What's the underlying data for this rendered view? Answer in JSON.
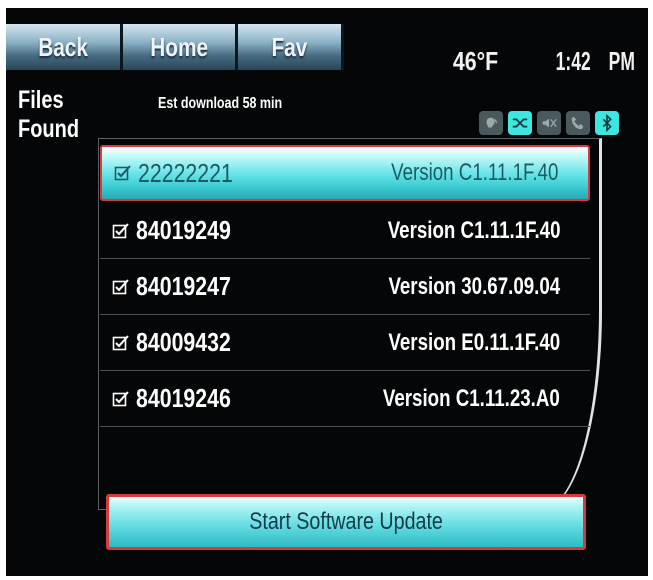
{
  "tabs": [
    {
      "label": "Back"
    },
    {
      "label": "Home"
    },
    {
      "label": "Fav"
    }
  ],
  "status": {
    "temperature": "46°F",
    "time": "1:42",
    "ampm": "PM"
  },
  "header": {
    "title": "Files Found",
    "estimate": "Est download 58 min"
  },
  "status_icons": [
    {
      "name": "voice-icon",
      "active": false
    },
    {
      "name": "shuffle-icon",
      "active": true
    },
    {
      "name": "mute-icon",
      "active": false
    },
    {
      "name": "phone-icon",
      "active": false
    },
    {
      "name": "bluetooth-icon",
      "active": true
    }
  ],
  "files": [
    {
      "id": "22222221",
      "version": "Version C1.11.1F.40",
      "checked": true,
      "selected": true
    },
    {
      "id": "84019249",
      "version": "Version C1.11.1F.40",
      "checked": true,
      "selected": false
    },
    {
      "id": "84019247",
      "version": "Version 30.67.09.04",
      "checked": true,
      "selected": false
    },
    {
      "id": "84009432",
      "version": "Version E0.11.1F.40",
      "checked": true,
      "selected": false
    },
    {
      "id": "84019246",
      "version": "Version C1.11.23.A0",
      "checked": true,
      "selected": false
    }
  ],
  "actions": {
    "start_label": "Start Software Update"
  },
  "colors": {
    "accent": "#3ee6e0",
    "highlight_border": "#d63b3b",
    "background": "#050607"
  }
}
